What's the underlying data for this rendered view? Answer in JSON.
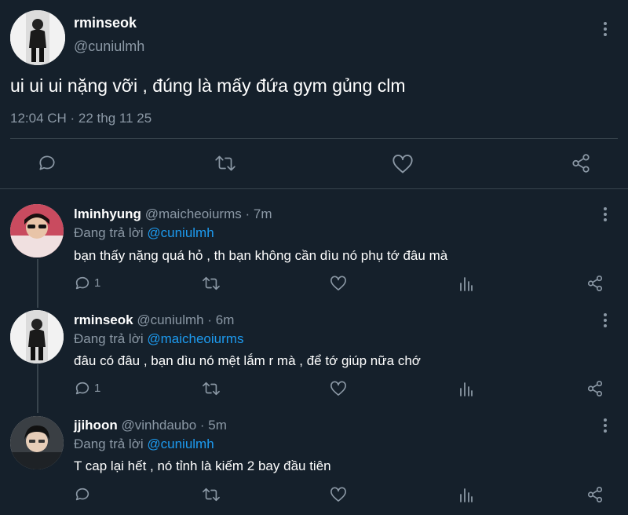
{
  "main_tweet": {
    "author_name": "rminseok",
    "author_handle": "@cuniulmh",
    "text": "ui ui ui nặng vỡi , đúng là mấy đứa gym gủng clm",
    "timestamp": "12:04 CH · 22 thg 11 25",
    "icons": [
      "reply-icon",
      "retweet-icon",
      "like-icon",
      "share-icon"
    ]
  },
  "replies": [
    {
      "author_name": "lminhyung",
      "author_handle": "@maicheoiurms",
      "time": "· 7m",
      "replying_label": "Đang trả lời",
      "replying_to": "@cuniulmh",
      "text": "bạn thấy nặng quá hỏ , th bạn không cần dìu nó phụ tớ đâu mà",
      "reply_count": "1"
    },
    {
      "author_name": "rminseok",
      "author_handle": "@cuniulmh",
      "time": "· 6m",
      "replying_label": "Đang trả lời",
      "replying_to": "@maicheoiurms",
      "text": "đâu có đâu , bạn dìu nó mệt lắm r mà , để tớ giúp nữa chớ",
      "reply_count": "1"
    },
    {
      "author_name": "jjihoon",
      "author_handle": "@vinhdaubo",
      "time": "· 5m",
      "replying_label": "Đang trả lời",
      "replying_to": "@cuniulmh",
      "text": "T cap lại hết , nó tỉnh là kiếm 2 bay đầu tiên",
      "reply_count": ""
    }
  ],
  "colors": {
    "background": "#15202b",
    "muted": "#8b98a5",
    "link": "#1d9bf0",
    "divider": "#38444d"
  }
}
